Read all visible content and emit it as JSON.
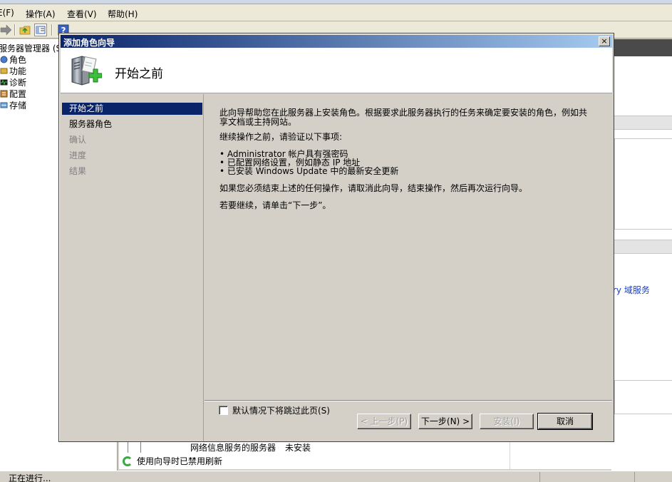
{
  "menubar": {
    "file": "E(F)",
    "action": "操作(A)",
    "view": "查看(V)",
    "help": "帮助(H)"
  },
  "tree": {
    "root": "服务器管理器 (S",
    "items": [
      {
        "label": "角色",
        "icon": "roles-icon"
      },
      {
        "label": "功能",
        "icon": "features-icon"
      },
      {
        "label": "诊断",
        "icon": "diagnostics-icon"
      },
      {
        "label": "配置",
        "icon": "configuration-icon"
      },
      {
        "label": "存储",
        "icon": "storage-icon"
      }
    ]
  },
  "background": {
    "ad_link": "ry 域服务",
    "role_row_name": "网络信息服务的服务器",
    "role_row_status": "未安装",
    "refresh_notice": "使用向导时已禁用刷新",
    "status": "正在进行..."
  },
  "wizard": {
    "title": "添加角色向导",
    "close": "×",
    "header_title": "开始之前",
    "nav": [
      {
        "label": "开始之前",
        "state": "active"
      },
      {
        "label": "服务器角色",
        "state": "enabled"
      },
      {
        "label": "确认",
        "state": "disabled"
      },
      {
        "label": "进度",
        "state": "disabled"
      },
      {
        "label": "结果",
        "state": "disabled"
      }
    ],
    "body": {
      "intro": "此向导帮助您在此服务器上安装角色。根据要求此服务器执行的任务来确定要安装的角色，例如共享文档或主持网站。",
      "verify": "继续操作之前，请验证以下事项:",
      "bullets": [
        "• Administrator 帐户具有强密码",
        "• 已配置网络设置，例如静态 IP 地址",
        "• 已安装 Windows Update 中的最新安全更新"
      ],
      "cancel_hint": "如果您必须结束上述的任何操作，请取消此向导，结束操作，然后再次运行向导。",
      "continue_hint": "若要继续，请单击“下一步”。"
    },
    "skip_label": "默认情况下将跳过此页(S)",
    "buttons": {
      "prev": "< 上一步(P)",
      "next": "下一步(N) >",
      "install": "安装(I)",
      "cancel": "取消"
    }
  },
  "colors": {
    "title_gradient_start": "#0a246a",
    "title_gradient_end": "#a6caf0",
    "selection": "#0a246a",
    "link": "#1a3fc0"
  }
}
